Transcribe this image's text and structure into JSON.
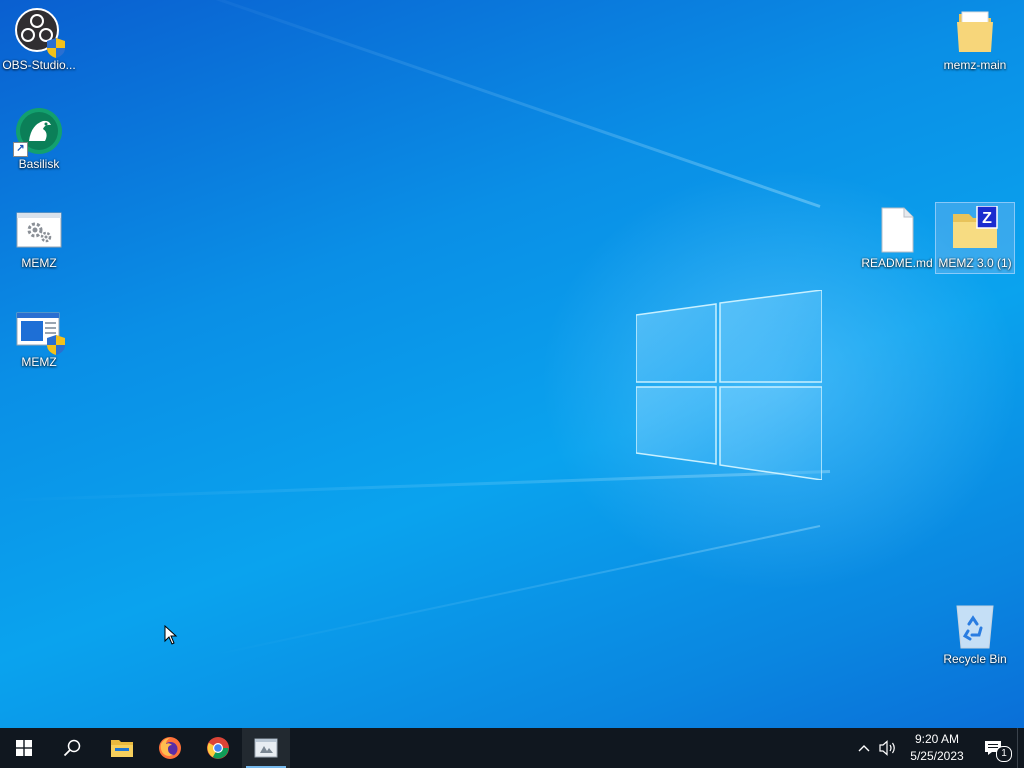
{
  "desktop": {
    "icons_left": [
      {
        "label": "OBS-Studio...",
        "icon": "obs-icon"
      },
      {
        "label": "Basilisk",
        "icon": "basilisk-icon"
      },
      {
        "label": "MEMZ",
        "icon": "settings-window-icon"
      },
      {
        "label": "MEMZ",
        "icon": "shielded-app-icon"
      }
    ],
    "icons_right": [
      {
        "label": "memz-main",
        "icon": "folder-icon"
      },
      {
        "label": "README.md",
        "icon": "document-icon"
      },
      {
        "label": "MEMZ 3.0 (1)",
        "icon": "zip-folder-icon",
        "selected": true
      },
      {
        "label": "Recycle Bin",
        "icon": "recycle-bin-icon"
      }
    ]
  },
  "taskbar": {
    "start": "windows-logo-icon",
    "search": "search-icon",
    "pinned": [
      {
        "name": "file-explorer",
        "icon": "folder-icon"
      },
      {
        "name": "firefox",
        "icon": "firefox-icon"
      },
      {
        "name": "chrome",
        "icon": "chrome-icon"
      },
      {
        "name": "memz-app",
        "icon": "app-window-icon",
        "active": true
      }
    ],
    "tray": {
      "time": "9:20 AM",
      "date": "5/25/2023",
      "notification_count": "1"
    }
  },
  "colors": {
    "desktop_blue": "#0a8fe6",
    "taskbar": "#10171f",
    "accent": "#76b9ed"
  }
}
